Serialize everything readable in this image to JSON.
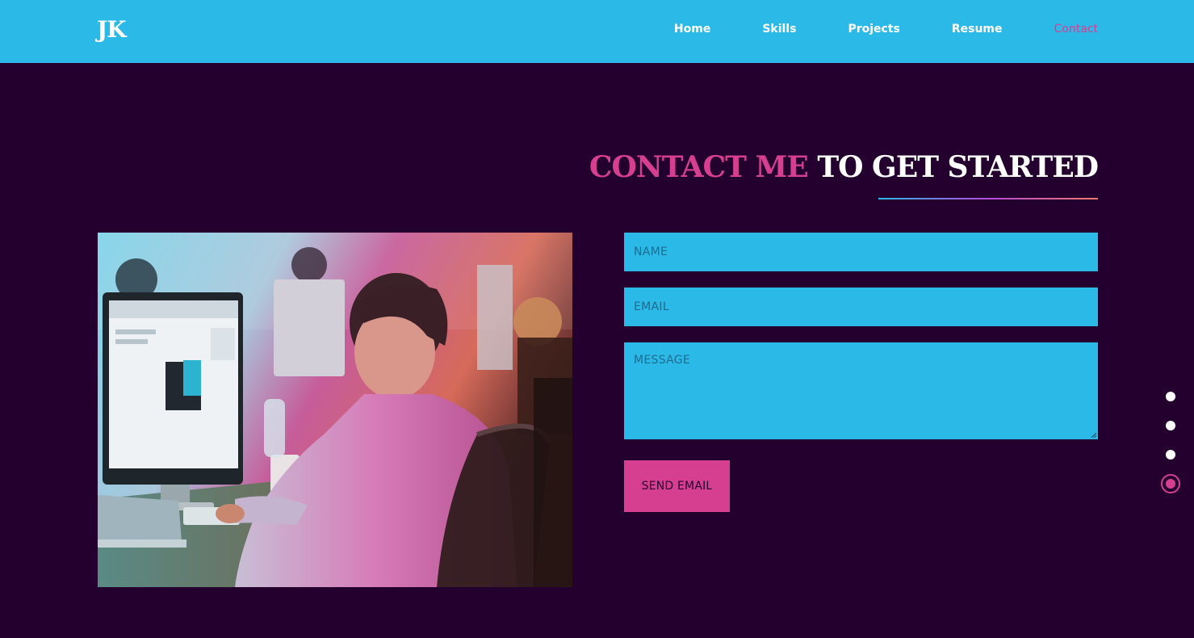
{
  "header": {
    "logo": "JK",
    "nav": [
      {
        "label": "Home",
        "active": false
      },
      {
        "label": "Skills",
        "active": false
      },
      {
        "label": "Projects",
        "active": false
      },
      {
        "label": "Resume",
        "active": false
      },
      {
        "label": "Contact",
        "active": true
      }
    ]
  },
  "contact": {
    "heading_highlight": "CONTACT ME",
    "heading_rest": "TO GET STARTED",
    "photo_alt": "man working at a computer in an office",
    "form": {
      "name_placeholder": "NAME",
      "email_placeholder": "EMAIL",
      "message_placeholder": "MESSAGE",
      "submit_label": "SEND EMAIL"
    }
  },
  "section_nav": {
    "count": 4,
    "active_index": 3
  },
  "colors": {
    "header_bg": "#2bbae8",
    "page_bg": "#24002f",
    "accent": "#d63e8f",
    "field_bg": "#2bbae8"
  }
}
